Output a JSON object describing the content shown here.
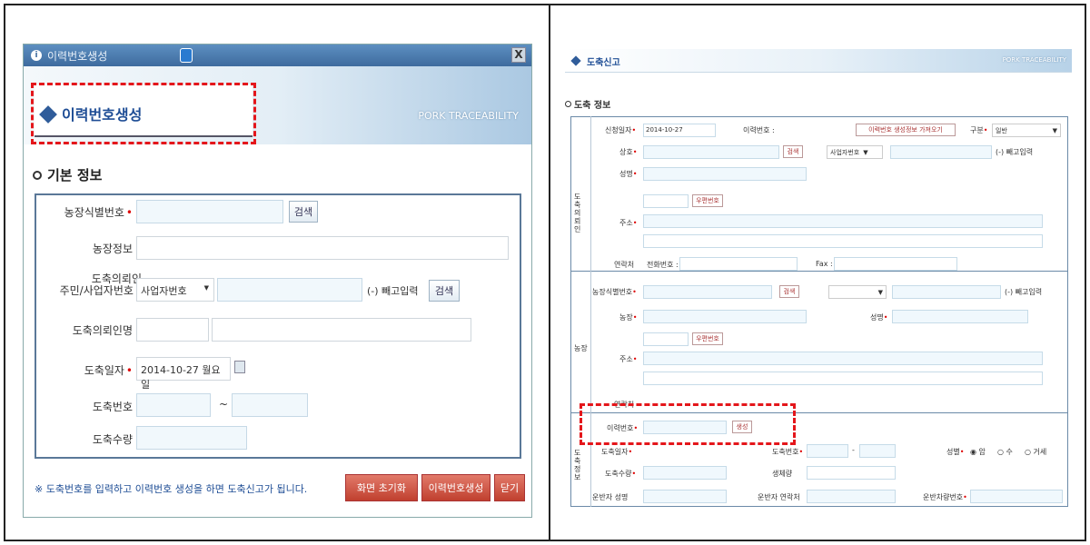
{
  "left": {
    "title": "이력번호생성",
    "header_title": "이력번호생성",
    "brand": "PORK TRACEABILITY",
    "section_title": "기본 정보",
    "labels": {
      "farm_id": "농장식별번호",
      "farm_info": "농장정보",
      "requester_id_line1": "도축의뢰인",
      "requester_id_line2": "주민/사업자번호",
      "requester_name": "도축의뢰인명",
      "date": "도축일자",
      "number": "도축번호",
      "qty": "도축수량"
    },
    "search1": "검색",
    "search2": "검색",
    "id_type": "사업자번호",
    "id_hint": "(-) 빼고입력",
    "date_value": "2014-10-27 월요일",
    "number_sep": "~",
    "notice": "※ 도축번호를 입력하고 이력번호 생성을 하면 도축신고가 됩니다.",
    "btn_reset": "화면 초기화",
    "btn_generate": "이력번호생성",
    "btn_close": "닫기"
  },
  "right": {
    "title": "도축신고",
    "brand": "PORK TRACEABILITY",
    "section_title": "도축 정보",
    "apply_date_label": "신청일자",
    "apply_date": "2014-10-27",
    "trace_no_label": "이력번호 :",
    "trace_btn": "이력번호 생성정보 가져오기",
    "type_label": "구분",
    "type_value": "일반",
    "requester_group": "도축의뢰인",
    "farm_group": "농장",
    "slaughter_group": "도축정보",
    "r_name": "상호",
    "search": "검색",
    "biz_no": "사업자번호",
    "hint": "(-) 빼고입력",
    "r_rep": "성명",
    "zip": "우편번호",
    "addr": "주소",
    "contact": "연락처",
    "phone": "전화번호 :",
    "fax": "Fax :",
    "farm_id": "농장식별번호",
    "farm_name": "농장",
    "owner": "성명",
    "zip2": "우편번호",
    "addr2": "주소",
    "contact2": "연락처",
    "trace_label": "이력번호",
    "gen_btn": "생성",
    "slaughter_date_label": "도축일자",
    "slaughter_no_label": "도축번호",
    "sex_label": "성별",
    "sex_opts": [
      "암",
      "수",
      "거세"
    ],
    "qty_label": "도축수량",
    "birth_label": "생체량",
    "carrier_name": "운반자 성명",
    "carrier_contact": "운반자 연락처",
    "carrier_car": "운반차량번호"
  }
}
